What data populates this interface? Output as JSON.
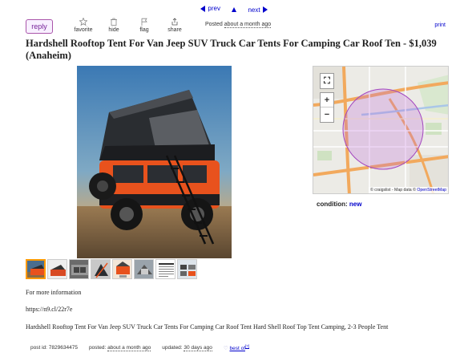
{
  "nav": {
    "prev": "prev",
    "next": "next"
  },
  "actions": {
    "reply": "reply",
    "favorite": "favorite",
    "hide": "hide",
    "flag": "flag",
    "share": "share",
    "posted_prefix": "Posted",
    "posted_when": "about a month ago",
    "print": "print"
  },
  "title": "Hardshell Rooftop Tent For Van Jeep SUV Truck Car Tents For Camping Car Roof Ten - $1,039 (Anaheim)",
  "map": {
    "attribution_prefix": "© craigslist - Map data ©",
    "attribution_link": "OpenStreetMap",
    "fullscreen": "⛶",
    "zoom_in": "+",
    "zoom_out": "−"
  },
  "condition": {
    "label": "condition:",
    "value": "new"
  },
  "description": {
    "line1": "For more information",
    "line2": "https://n9.cl/22r7e",
    "line3": "Hardshell Rooftop Tent For Van Jeep SUV Truck Car Tents For Camping Car Roof Tent Hard Shell Roof Top Tent Camping, 2-3 People Tent"
  },
  "footer": {
    "post_id_label": "post id:",
    "post_id": "7829634475",
    "posted_label": "posted:",
    "posted_value": "about a month ago",
    "updated_label": "updated:",
    "updated_value": "30 days ago",
    "best_of": "best of",
    "best_of_sup": "[?]"
  },
  "colors": {
    "link": "#0000cc",
    "reply_border": "#aa55aa",
    "thumb_active": "#ff9900"
  }
}
